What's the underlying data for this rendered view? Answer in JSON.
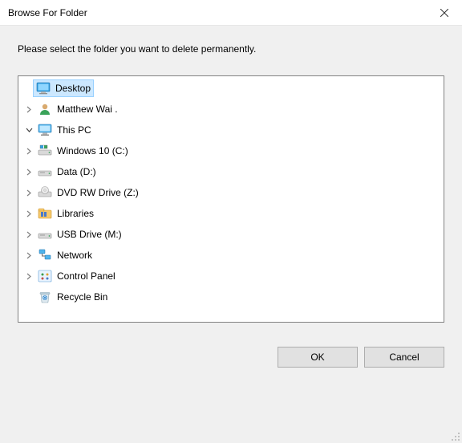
{
  "window": {
    "title": "Browse For Folder"
  },
  "instruction": "Please select the folder you want to delete permanently.",
  "tree": {
    "root": {
      "label": "Desktop",
      "icon": "desktop",
      "selected": true
    },
    "items": [
      {
        "label": "Matthew Wai .",
        "icon": "user",
        "expander": "closed",
        "indent": 1
      },
      {
        "label": "This PC",
        "icon": "this-pc",
        "expander": "open",
        "indent": 1
      },
      {
        "label": "Windows 10 (C:)",
        "icon": "drive-os",
        "expander": "closed",
        "indent": 2
      },
      {
        "label": "Data (D:)",
        "icon": "drive-hdd",
        "expander": "closed",
        "indent": 2
      },
      {
        "label": "DVD RW Drive (Z:)",
        "icon": "drive-optical",
        "expander": "closed",
        "indent": 2
      },
      {
        "label": "Libraries",
        "icon": "libraries",
        "expander": "closed",
        "indent": 1
      },
      {
        "label": "USB Drive (M:)",
        "icon": "drive-usb",
        "expander": "closed",
        "indent": 1
      },
      {
        "label": "Network",
        "icon": "network",
        "expander": "closed",
        "indent": 1
      },
      {
        "label": "Control Panel",
        "icon": "control-panel",
        "expander": "closed",
        "indent": 1
      },
      {
        "label": "Recycle Bin",
        "icon": "recycle-bin",
        "expander": "none",
        "indent": 1
      }
    ]
  },
  "buttons": {
    "ok": "OK",
    "cancel": "Cancel"
  }
}
